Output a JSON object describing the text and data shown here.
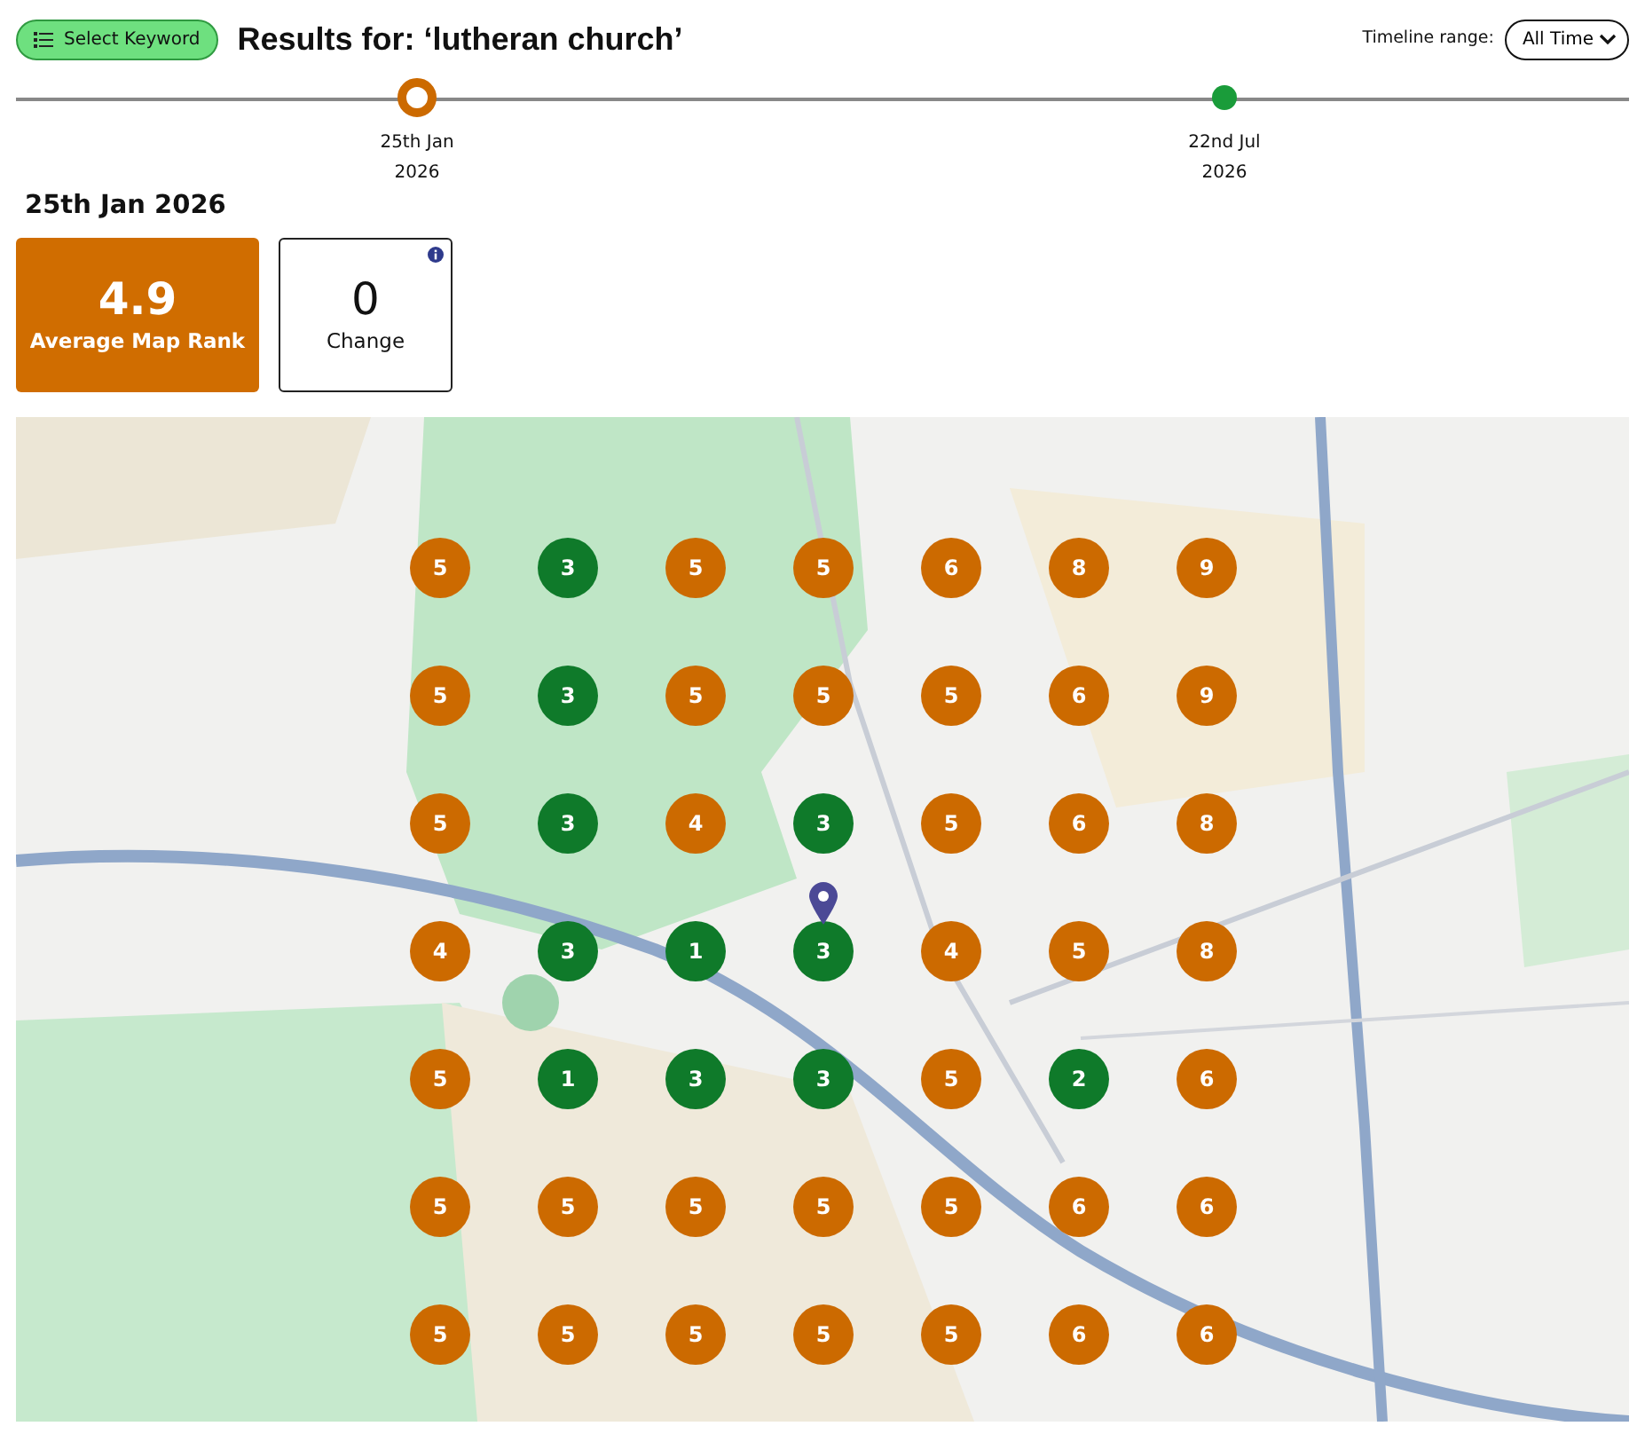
{
  "header": {
    "keyword_button": "Select Keyword",
    "title": "Results for: ‘lutheran church’",
    "range_label": "Timeline range:",
    "range_value": "All Time"
  },
  "timeline": [
    {
      "label": "25th Jan",
      "year": "2026",
      "selected": true,
      "color": "#cc6a00"
    },
    {
      "label": "22nd Jul",
      "year": "2026",
      "selected": false,
      "color": "#1a9c3a"
    }
  ],
  "date_heading": "25th Jan 2026",
  "stats": [
    {
      "kind": "highlight",
      "value": "4.9",
      "label": "Average Map Rank"
    },
    {
      "kind": "plain",
      "value": "0",
      "label": "Change",
      "info": true
    }
  ],
  "map": {
    "kind": "picture",
    "grid": [
      [
        {
          "rank": "5",
          "color": "#cc6a00"
        },
        {
          "rank": "3",
          "color": "#0f7a2a"
        },
        {
          "rank": "5",
          "color": "#cc6a00"
        },
        {
          "rank": "5",
          "color": "#cc6a00"
        },
        {
          "rank": "6",
          "color": "#cc6a00"
        },
        {
          "rank": "8",
          "color": "#cc6a00"
        },
        {
          "rank": "9",
          "color": "#cc6a00"
        }
      ],
      [
        {
          "rank": "5",
          "color": "#cc6a00"
        },
        {
          "rank": "3",
          "color": "#0f7a2a"
        },
        {
          "rank": "5",
          "color": "#cc6a00"
        },
        {
          "rank": "5",
          "color": "#cc6a00"
        },
        {
          "rank": "5",
          "color": "#cc6a00"
        },
        {
          "rank": "6",
          "color": "#cc6a00"
        },
        {
          "rank": "9",
          "color": "#cc6a00"
        }
      ],
      [
        {
          "rank": "5",
          "color": "#cc6a00"
        },
        {
          "rank": "3",
          "color": "#0f7a2a"
        },
        {
          "rank": "4",
          "color": "#cc6a00"
        },
        {
          "rank": "3",
          "color": "#0f7a2a"
        },
        {
          "rank": "5",
          "color": "#cc6a00"
        },
        {
          "rank": "6",
          "color": "#cc6a00"
        },
        {
          "rank": "8",
          "color": "#cc6a00"
        }
      ],
      [
        {
          "rank": "4",
          "color": "#cc6a00"
        },
        {
          "rank": "3",
          "color": "#0f7a2a"
        },
        {
          "rank": "1",
          "color": "#0f7a2a"
        },
        {
          "rank": "3",
          "color": "#0f7a2a",
          "pin": true
        },
        {
          "rank": "4",
          "color": "#cc6a00"
        },
        {
          "rank": "5",
          "color": "#cc6a00"
        },
        {
          "rank": "8",
          "color": "#cc6a00"
        }
      ],
      [
        {
          "rank": "5",
          "color": "#cc6a00"
        },
        {
          "rank": "1",
          "color": "#0f7a2a"
        },
        {
          "rank": "3",
          "color": "#0f7a2a"
        },
        {
          "rank": "3",
          "color": "#0f7a2a"
        },
        {
          "rank": "5",
          "color": "#cc6a00"
        },
        {
          "rank": "2",
          "color": "#0f7a2a"
        },
        {
          "rank": "6",
          "color": "#cc6a00"
        }
      ],
      [
        {
          "rank": "5",
          "color": "#cc6a00"
        },
        {
          "rank": "5",
          "color": "#cc6a00"
        },
        {
          "rank": "5",
          "color": "#cc6a00"
        },
        {
          "rank": "5",
          "color": "#cc6a00"
        },
        {
          "rank": "5",
          "color": "#cc6a00"
        },
        {
          "rank": "6",
          "color": "#cc6a00"
        },
        {
          "rank": "6",
          "color": "#cc6a00"
        }
      ],
      [
        {
          "rank": "5",
          "color": "#cc6a00"
        },
        {
          "rank": "5",
          "color": "#cc6a00"
        },
        {
          "rank": "5",
          "color": "#cc6a00"
        },
        {
          "rank": "5",
          "color": "#cc6a00"
        },
        {
          "rank": "5",
          "color": "#cc6a00"
        },
        {
          "rank": "6",
          "color": "#cc6a00"
        },
        {
          "rank": "6",
          "color": "#cc6a00"
        }
      ]
    ]
  }
}
